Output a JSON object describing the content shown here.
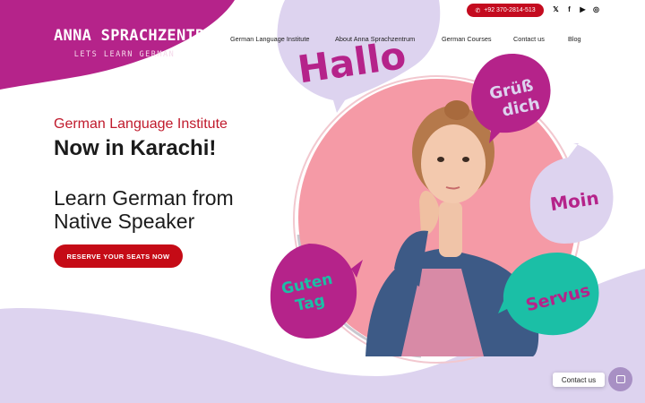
{
  "brand": {
    "name": "ANNA SPRACHZENTRUM",
    "tagline": "LETS LEARN GERMAN"
  },
  "topbar": {
    "phone": "+92 370-2814-513",
    "phone_icon": "phone-icon",
    "socials": [
      {
        "icon": "twitter-icon",
        "glyph": "𝕏"
      },
      {
        "icon": "facebook-icon",
        "glyph": "f"
      },
      {
        "icon": "youtube-icon",
        "glyph": "▶"
      },
      {
        "icon": "instagram-icon",
        "glyph": "◎"
      }
    ]
  },
  "nav": {
    "items": [
      "German Language Institute",
      "About Anna Sprachzentrum",
      "German Courses",
      "Contact us",
      "Blog"
    ]
  },
  "hero": {
    "eyebrow": "German Language Institute",
    "headline": "Now in Karachi!",
    "subheadline": "Learn German from Native Speaker",
    "cta": "RESERVE YOUR SEATS NOW"
  },
  "bubbles": {
    "hallo": "Hallo",
    "gruess_line1": "Grüß",
    "gruess_line2": "dich",
    "moin": "Moin",
    "guten_line1": "Guten",
    "guten_line2": "Tag",
    "servus": "Servus"
  },
  "widget": {
    "label": "Contact us"
  },
  "colors": {
    "magenta": "#b5238a",
    "lavender": "#ddd3ef",
    "pink_circle": "#f59aa6",
    "teal": "#1bbfa6",
    "red_cta": "#c50b16"
  }
}
